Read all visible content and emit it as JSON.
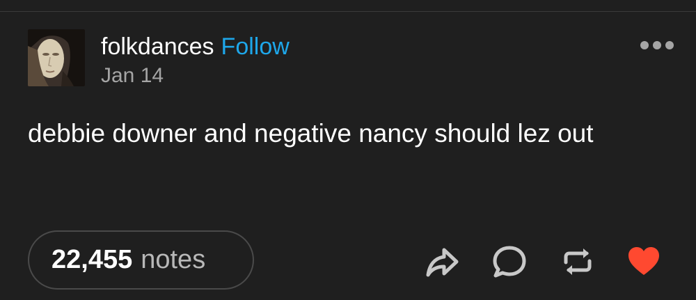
{
  "post": {
    "username": "folkdances",
    "follow_label": "Follow",
    "date": "Jan 14",
    "text": "debbie downer and negative nancy should lez out",
    "notes_count": "22,455",
    "notes_label": "notes"
  },
  "icons": {
    "more": "more-horizontal-icon",
    "share": "share-icon",
    "reply": "reply-icon",
    "reblog": "reblog-icon",
    "like": "heart-icon"
  },
  "colors": {
    "background": "#1f1f1f",
    "follow": "#1ea7ea",
    "like": "#ff4930",
    "muted_text": "#a5a5a5",
    "icon": "#c8c8c8"
  }
}
